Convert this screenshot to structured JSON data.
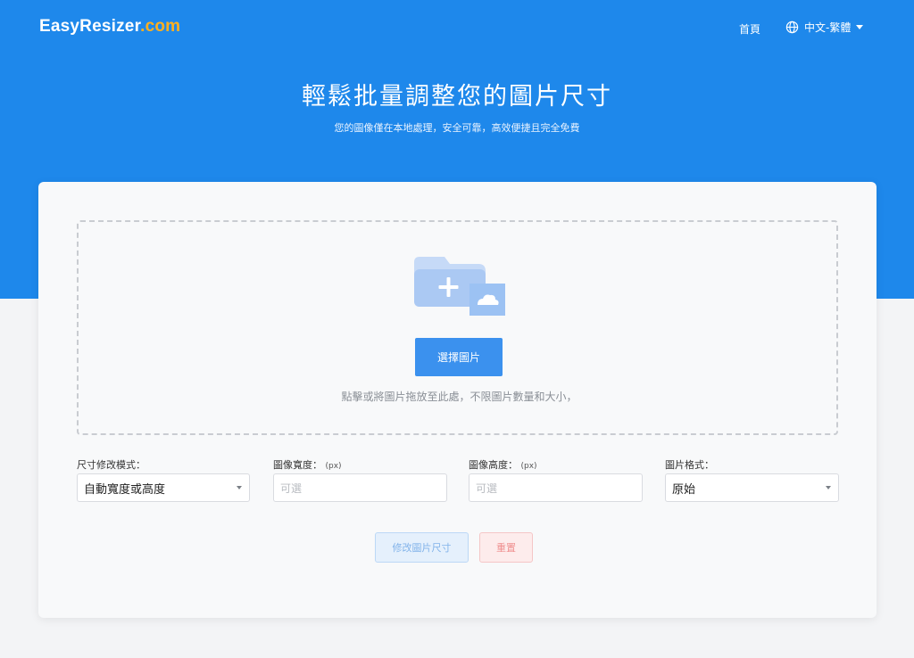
{
  "header": {
    "logo_main": "EasyResizer",
    "logo_suffix": ".com",
    "nav_home": "首頁",
    "language": "中文-繁體"
  },
  "hero": {
    "title": "輕鬆批量調整您的圖片尺寸",
    "subtitle": "您的圖像僅在本地處理，安全可靠，高效便捷且完全免費"
  },
  "upload": {
    "select_button": "選擇圖片",
    "hint": "點擊或將圖片拖放至此處，不限圖片數量和大小，"
  },
  "options": {
    "mode": {
      "label": "尺寸修改模式：",
      "value": "自動寬度或高度"
    },
    "width": {
      "label": "圖像寬度：",
      "unit": "(px)",
      "placeholder": "可選"
    },
    "height": {
      "label": "圖像高度：",
      "unit": "(px)",
      "placeholder": "可選"
    },
    "format": {
      "label": "圖片格式：",
      "value": "原始"
    }
  },
  "actions": {
    "resize_button": "修改圖片尺寸",
    "reset_button": "重置"
  },
  "colors": {
    "brand_blue": "#1e88eb",
    "logo_accent": "#ffb020",
    "primary_button": "#3b91ee"
  },
  "icons": {
    "language": "globe-icon",
    "upload": "folder-cloud-icon"
  }
}
